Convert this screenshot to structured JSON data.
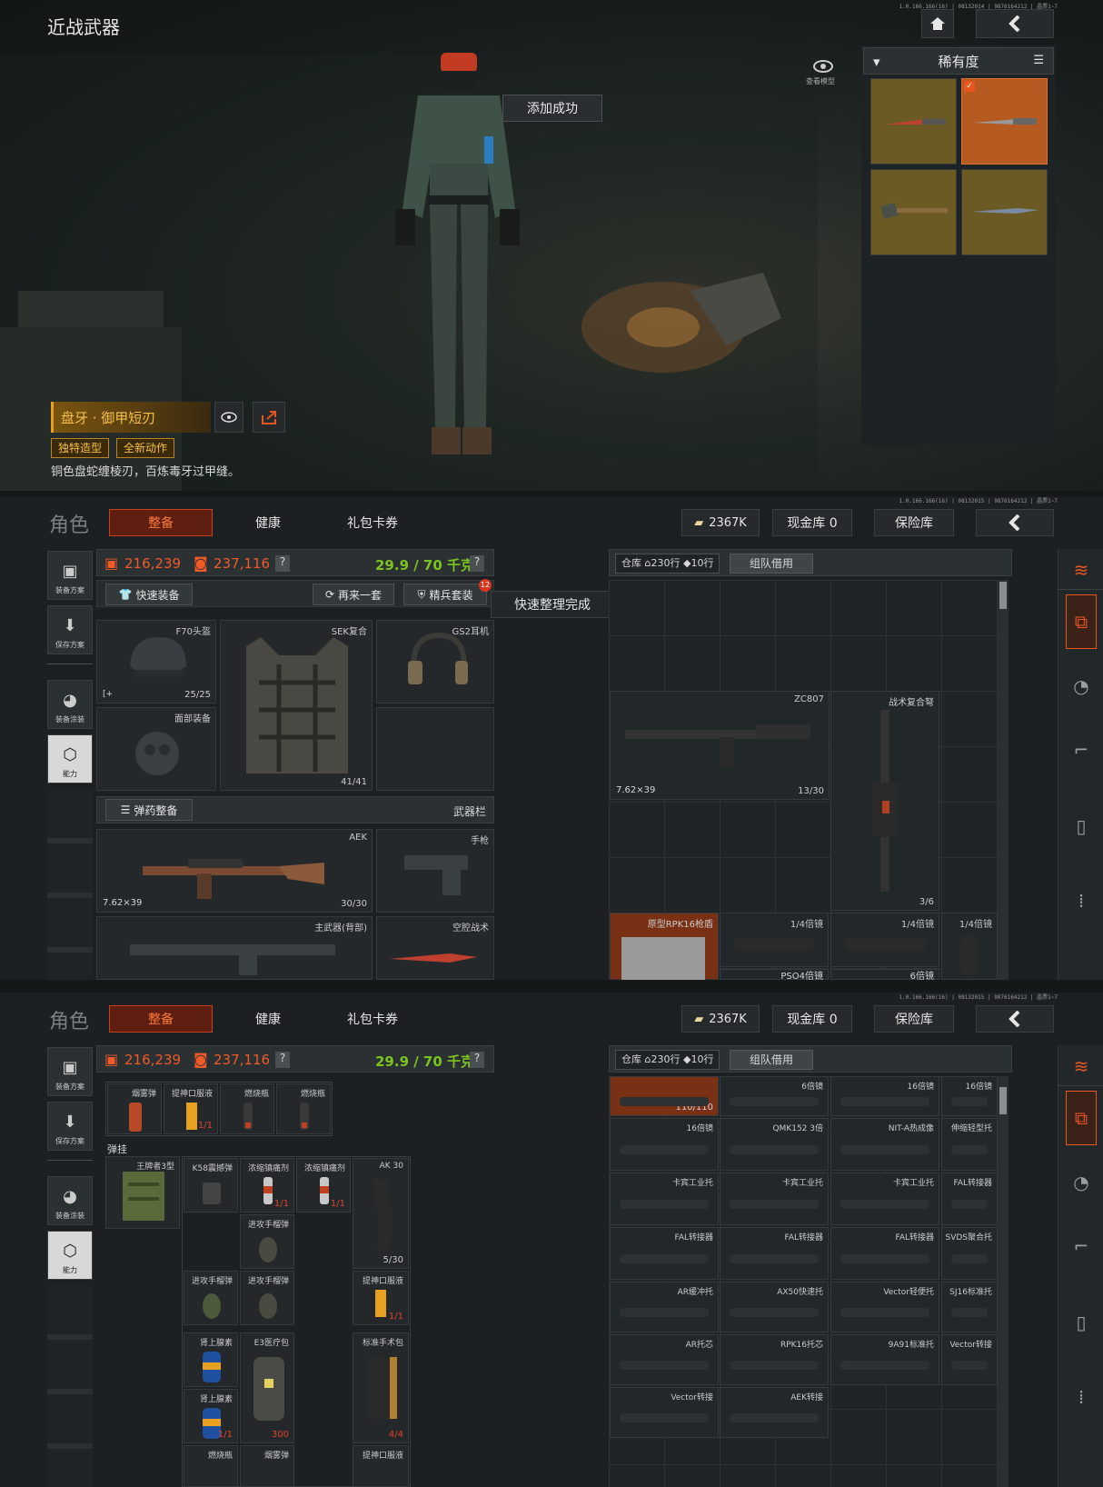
{
  "panel1": {
    "title": "近战武器",
    "version": "1.0.166.166(16) | 08132014 | 9876164212 | 晶票1~7",
    "view_model_label": "查看模型",
    "toast": "添加成功",
    "sort_label": "稀有度",
    "item_name": "盘牙 · 御甲短刃",
    "tags": [
      "独特造型",
      "全新动作"
    ],
    "description": "铜色盘蛇缠棱刃，百炼毒牙过甲缝。",
    "icons": {
      "home": "home-icon",
      "back": "back-chevron-icon",
      "eye": "eye-icon",
      "share": "share-icon",
      "sort": "sort-icon",
      "dropdown": "chevron-down-icon"
    }
  },
  "panel2": {
    "version": "1.0.166.166(16) | 08132015 | 9876164212 | 晶票1~7",
    "role_title": "角色",
    "tabs": [
      "整备",
      "健康",
      "礼包卡券"
    ],
    "currency": "2367K",
    "cash_vault": "现金库 0",
    "insurance": "保险库",
    "value_orange": "216,239",
    "value_orange2": "237,116",
    "weight": "29.9 / 70 千克",
    "help": "?",
    "quick_equip": "快速装备",
    "again": "再来一套",
    "elite": "精兵套装",
    "elite_badge": "12",
    "toast": "快速整理完成",
    "side_buttons": [
      "装备方案",
      "保存方案",
      "装备涂装",
      "能力"
    ],
    "helmet": {
      "label": "F70头盔",
      "count": "25/25"
    },
    "armor": {
      "label": "SEK复合",
      "count": "41/41"
    },
    "headset": {
      "label": "GS2耳机"
    },
    "face": {
      "label": "面部装备"
    },
    "ammo_btn": "弹药整备",
    "weapon_slot": "武器栏",
    "primary": {
      "label": "AEK",
      "ammo": "7.62×39",
      "count": "30/30"
    },
    "pistol": {
      "label": "手枪"
    },
    "primary_back": {
      "label": "主武器(背部)"
    },
    "melee": {
      "label": "空腔战术"
    },
    "storage": {
      "label": "仓库",
      "rows": "230行",
      "cols": "10行",
      "team_btn": "组队借用"
    },
    "storage_items": [
      {
        "label": "ZC807",
        "ammo": "7.62×39",
        "count": "13/30"
      },
      {
        "label": "战术复合弩",
        "count": "3/6"
      },
      {
        "label": "原型RPK16枪盾"
      },
      {
        "label": "1/4倍镜"
      },
      {
        "label": "1/4倍镜"
      },
      {
        "label": "1/4倍镜"
      },
      {
        "label": "PSO4倍镜"
      },
      {
        "label": "6倍镜"
      }
    ]
  },
  "panel3": {
    "version": "1.0.166.166(16) | 08132015 | 9876164212 | 晶票1~7",
    "role_title": "角色",
    "tabs": [
      "整备",
      "健康",
      "礼包卡券"
    ],
    "currency": "2367K",
    "cash_vault": "现金库 0",
    "insurance": "保险库",
    "value_orange": "216,239",
    "value_orange2": "237,116",
    "weight": "29.9 / 70 千克",
    "help": "?",
    "side_buttons": [
      "装备方案",
      "保存方案",
      "装备涂装",
      "能力"
    ],
    "pouch_items": [
      {
        "label": "烟雾弹"
      },
      {
        "label": "提神口服液",
        "count": "1/1"
      },
      {
        "label": "燃烧瓶"
      },
      {
        "label": "燃烧瓶"
      }
    ],
    "rig_label": "弹挂",
    "rig_name": "王牌者3型",
    "rig_items": [
      {
        "label": "K58震撼弹"
      },
      {
        "label": "浓缩镇痛剂",
        "count": "1/1"
      },
      {
        "label": "浓缩镇痛剂",
        "count": "1/1"
      },
      {
        "label": "AK 30",
        "count": "5/30"
      },
      {
        "label": "进攻手榴弹"
      },
      {
        "label": "进攻手榴弹"
      },
      {
        "label": "进攻手榴弹"
      },
      {
        "label": "提神口服液",
        "count": "1/1"
      },
      {
        "label": "肾上腺素"
      },
      {
        "label": "E3医疗包",
        "count": "300"
      },
      {
        "label": "标准手术包",
        "count": "4/4"
      },
      {
        "label": "肾上腺素",
        "count": "1/1"
      },
      {
        "label": "燃烧瓶"
      },
      {
        "label": "烟雾弹"
      },
      {
        "label": "提神口服液"
      }
    ],
    "storage": {
      "label": "仓库",
      "rows": "230行",
      "cols": "10行",
      "team_btn": "组队借用"
    },
    "storage_items": [
      {
        "label": "",
        "count": "110/110"
      },
      {
        "label": "6倍镜"
      },
      {
        "label": "16倍镜"
      },
      {
        "label": "16倍镜"
      },
      {
        "label": "16倍镜"
      },
      {
        "label": "QMK152 3倍"
      },
      {
        "label": "NIT-A热成像"
      },
      {
        "label": "伸缩轻型托"
      },
      {
        "label": "卡宾工业托"
      },
      {
        "label": "卡宾工业托"
      },
      {
        "label": "卡宾工业托"
      },
      {
        "label": "FAL转接器"
      },
      {
        "label": "FAL转接器"
      },
      {
        "label": "FAL转接器"
      },
      {
        "label": "FAL转接器"
      },
      {
        "label": "SVDS聚合托"
      },
      {
        "label": "AR缓冲托"
      },
      {
        "label": "AX50快速托"
      },
      {
        "label": "Vector轻便托"
      },
      {
        "label": "SJ16标准托"
      },
      {
        "label": "AR托芯"
      },
      {
        "label": "RPK16托芯"
      },
      {
        "label": "9A91标准托"
      },
      {
        "label": "Vector转接"
      },
      {
        "label": "Vector转接"
      },
      {
        "label": "AEK转接"
      }
    ]
  },
  "colors": {
    "accent": "#c8421e",
    "gold": "#e8a020",
    "green": "#7bc41f",
    "orange_value": "#f05a28"
  }
}
